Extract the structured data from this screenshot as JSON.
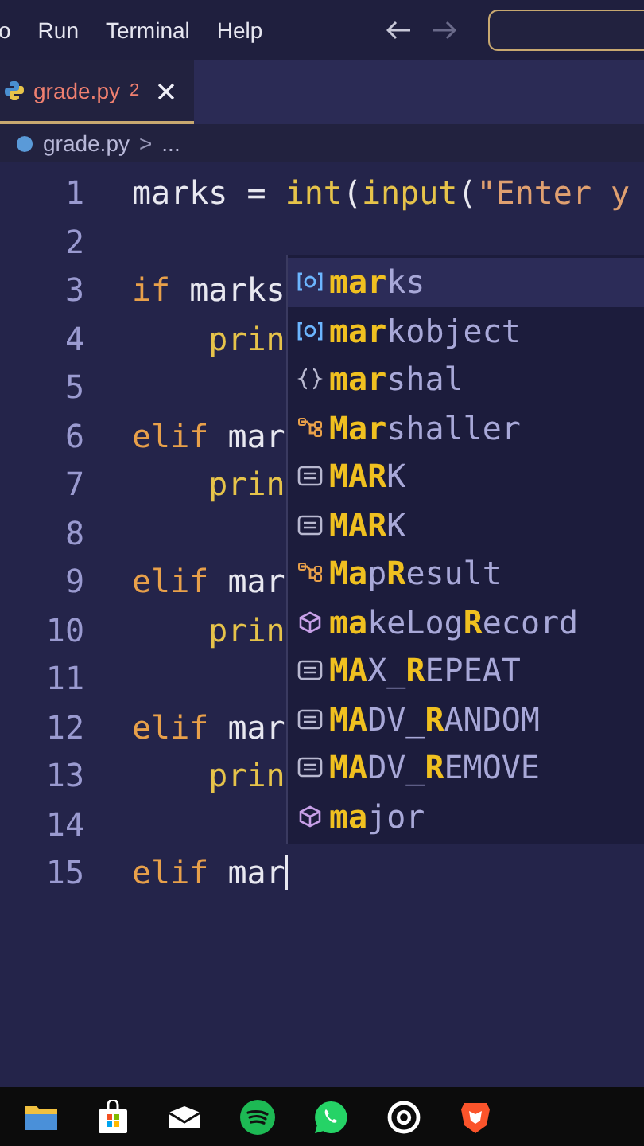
{
  "menu_bar": {
    "items": [
      "o",
      "Run",
      "Terminal",
      "Help"
    ]
  },
  "tabs": [
    {
      "label": "grade.py",
      "problems": "2",
      "selected": true
    }
  ],
  "breadcrumb": {
    "file": "grade.py",
    "separator": ">",
    "rest": "..."
  },
  "editor": {
    "lines": [
      {
        "number": "1",
        "tokens": [
          {
            "text": "marks = ",
            "kind": "ident"
          },
          {
            "text": "int",
            "kind": "func"
          },
          {
            "text": "(",
            "kind": "ident"
          },
          {
            "text": "input",
            "kind": "func"
          },
          {
            "text": "(",
            "kind": "ident"
          },
          {
            "text": "\"Enter y",
            "kind": "string"
          }
        ]
      },
      {
        "number": "2"
      },
      {
        "number": "3",
        "tokens": [
          {
            "text": "if",
            "kind": "keyword"
          },
          {
            "text": " marks",
            "kind": "ident"
          }
        ]
      },
      {
        "number": "4",
        "tokens": [
          {
            "text": "    prin",
            "kind": "func"
          }
        ]
      },
      {
        "number": "5"
      },
      {
        "number": "6",
        "tokens": [
          {
            "text": "elif",
            "kind": "keyword"
          },
          {
            "text": " mar",
            "kind": "ident"
          }
        ]
      },
      {
        "number": "7",
        "tokens": [
          {
            "text": "    prin",
            "kind": "func"
          }
        ]
      },
      {
        "number": "8"
      },
      {
        "number": "9",
        "tokens": [
          {
            "text": "elif",
            "kind": "keyword"
          },
          {
            "text": " mar",
            "kind": "ident"
          }
        ]
      },
      {
        "number": "10",
        "tokens": [
          {
            "text": "    prin",
            "kind": "func"
          }
        ]
      },
      {
        "number": "11"
      },
      {
        "number": "12",
        "tokens": [
          {
            "text": "elif",
            "kind": "keyword"
          },
          {
            "text": " mar",
            "kind": "ident"
          }
        ]
      },
      {
        "number": "13",
        "tokens": [
          {
            "text": "    prin",
            "kind": "func"
          }
        ]
      },
      {
        "number": "14"
      },
      {
        "number": "15",
        "tokens": [
          {
            "text": "elif",
            "kind": "keyword"
          },
          {
            "text": " mar",
            "kind": "ident"
          }
        ],
        "cursor": true
      }
    ]
  },
  "suggestions": [
    {
      "kind": "variable",
      "selected": true,
      "parts": [
        {
          "text": "mar",
          "match": true
        },
        {
          "text": "ks",
          "match": false
        }
      ]
    },
    {
      "kind": "variable",
      "selected": false,
      "parts": [
        {
          "text": "mar",
          "match": true
        },
        {
          "text": "kobject",
          "match": false
        }
      ]
    },
    {
      "kind": "module",
      "selected": false,
      "parts": [
        {
          "text": "mar",
          "match": true
        },
        {
          "text": "shal",
          "match": false
        }
      ]
    },
    {
      "kind": "class",
      "selected": false,
      "parts": [
        {
          "text": "Mar",
          "match": true
        },
        {
          "text": "shaller",
          "match": false
        }
      ]
    },
    {
      "kind": "constant",
      "selected": false,
      "parts": [
        {
          "text": "MAR",
          "match": true
        },
        {
          "text": "K",
          "match": false
        }
      ]
    },
    {
      "kind": "constant",
      "selected": false,
      "parts": [
        {
          "text": "MAR",
          "match": true
        },
        {
          "text": "K",
          "match": false
        }
      ]
    },
    {
      "kind": "class",
      "selected": false,
      "parts": [
        {
          "text": "Ma",
          "match": true
        },
        {
          "text": "p",
          "match": false
        },
        {
          "text": "R",
          "match": true
        },
        {
          "text": "esult",
          "match": false
        }
      ]
    },
    {
      "kind": "method",
      "selected": false,
      "parts": [
        {
          "text": "ma",
          "match": true
        },
        {
          "text": "keLog",
          "match": false
        },
        {
          "text": "R",
          "match": true
        },
        {
          "text": "ecord",
          "match": false
        }
      ]
    },
    {
      "kind": "constant",
      "selected": false,
      "parts": [
        {
          "text": "MA",
          "match": true
        },
        {
          "text": "X_",
          "match": false
        },
        {
          "text": "R",
          "match": true
        },
        {
          "text": "EPEAT",
          "match": false
        }
      ]
    },
    {
      "kind": "constant",
      "selected": false,
      "parts": [
        {
          "text": "MA",
          "match": true
        },
        {
          "text": "DV_",
          "match": false
        },
        {
          "text": "R",
          "match": true
        },
        {
          "text": "ANDOM",
          "match": false
        }
      ]
    },
    {
      "kind": "constant",
      "selected": false,
      "parts": [
        {
          "text": "MA",
          "match": true
        },
        {
          "text": "DV_",
          "match": false
        },
        {
          "text": "R",
          "match": true
        },
        {
          "text": "EMOVE",
          "match": false
        }
      ]
    },
    {
      "kind": "method",
      "selected": false,
      "parts": [
        {
          "text": "ma",
          "match": true
        },
        {
          "text": "jor",
          "match": false
        }
      ]
    }
  ],
  "taskbar": {
    "apps": [
      {
        "kind": "folder"
      },
      {
        "kind": "store"
      },
      {
        "kind": "mail"
      },
      {
        "kind": "music"
      },
      {
        "kind": "chat"
      },
      {
        "kind": "target"
      },
      {
        "kind": "lion"
      }
    ]
  }
}
